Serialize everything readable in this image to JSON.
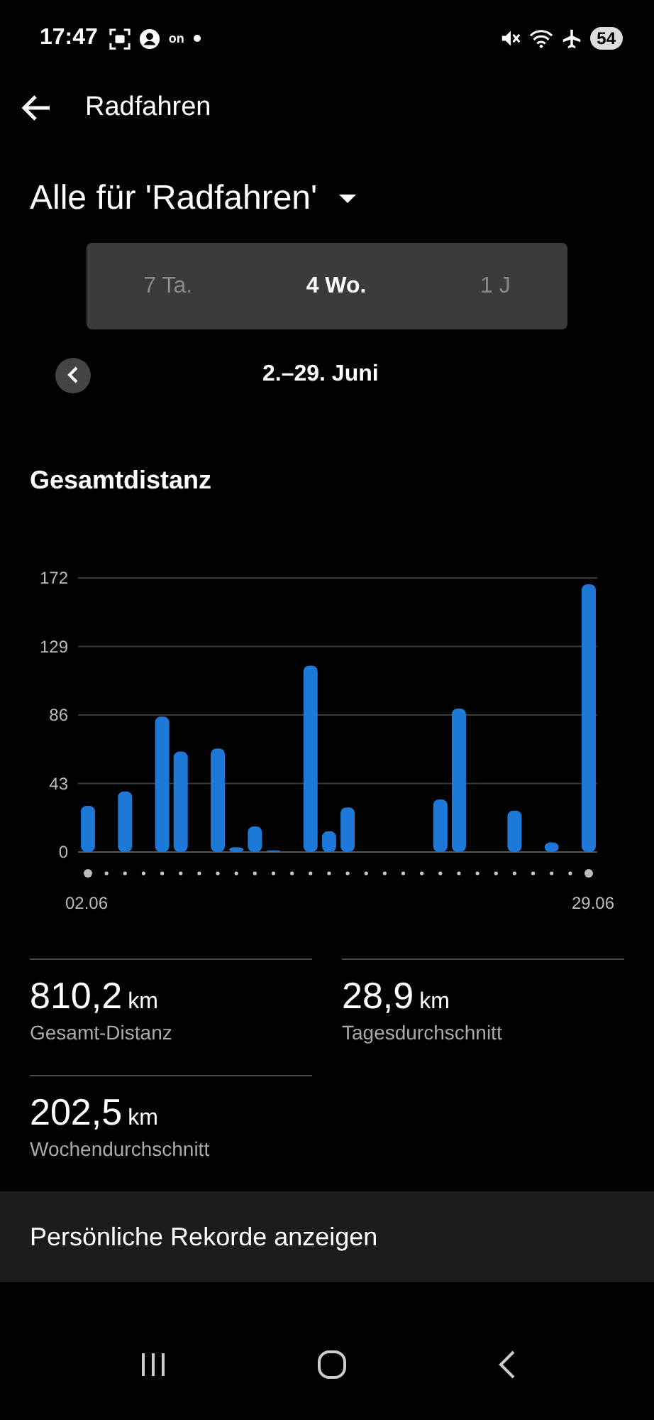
{
  "status_bar": {
    "time": "17:47",
    "notification_text": "on",
    "battery": "54"
  },
  "header": {
    "title": "Radfahren"
  },
  "filter": {
    "label": "Alle für 'Radfahren'"
  },
  "tabs": [
    {
      "label": "7 Ta.",
      "selected": false
    },
    {
      "label": "4 Wo.",
      "selected": true
    },
    {
      "label": "1 J",
      "selected": false
    }
  ],
  "period": {
    "label": "2.–29. Juni"
  },
  "section": {
    "title": "Gesamtdistanz",
    "chart_data": {
      "type": "bar",
      "categories": [
        "02.06",
        null,
        null,
        null,
        null,
        null,
        null,
        null,
        null,
        null,
        null,
        null,
        null,
        null,
        null,
        null,
        null,
        null,
        null,
        null,
        null,
        null,
        null,
        null,
        null,
        null,
        null,
        "29.06"
      ],
      "grid": true,
      "series": [
        {
          "color": "#1e78d7",
          "values": [
            29,
            0,
            38,
            0,
            85,
            63,
            0,
            65,
            3,
            16,
            1,
            0,
            117,
            13,
            28,
            0,
            0,
            0,
            0,
            33,
            90,
            0,
            0,
            26,
            0,
            6,
            0,
            168
          ]
        }
      ],
      "ylim": [
        0,
        172
      ],
      "yticks": [
        0,
        43,
        86,
        129,
        172
      ]
    }
  },
  "stats": [
    {
      "value": "810,2",
      "unit": "km",
      "label": "Gesamt-Distanz"
    },
    {
      "value": "28,9",
      "unit": "km",
      "label": "Tagesdurchschnitt"
    },
    {
      "value": "202,5",
      "unit": "km",
      "label": "Wochendurchschnitt"
    }
  ],
  "records_button": {
    "label": "Persönliche Rekorde anzeigen"
  }
}
